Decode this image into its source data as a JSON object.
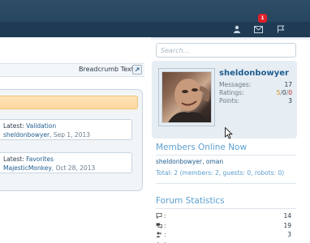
{
  "topnav": {
    "notification_count": "1",
    "icons": [
      "user-icon",
      "inbox-icon",
      "flag-icon"
    ]
  },
  "search": {
    "placeholder": "Search..."
  },
  "breadcrumb": {
    "text": "Breadcrumb Text"
  },
  "forum_list": {
    "items": [
      {
        "latest_label": "Latest:",
        "thread": "Validation",
        "user": "sheldonbowyer",
        "date": "Sep 1, 2013"
      },
      {
        "latest_label": "Latest:",
        "thread": "Favorites",
        "user": "MajesticMonkey",
        "date": "Oct 28, 2013"
      }
    ]
  },
  "visitor": {
    "username": "sheldonbowyer",
    "stats": [
      {
        "label": "Messages:",
        "value": "17"
      },
      {
        "label": "Ratings:",
        "pos": "5",
        "neu": "0",
        "neg": "0"
      },
      {
        "label": "Points:",
        "value": "3"
      }
    ]
  },
  "members_online": {
    "title": "Members Online Now",
    "users": "sheldonbowyer, oman",
    "total": "Total: 2 (members: 2, guests: 0, robots: 0)"
  },
  "forum_stats": {
    "title": "Forum Statistics",
    "rows": [
      {
        "icon": "speech-bubble-icon",
        "label": ":",
        "value": "14"
      },
      {
        "icon": "chat-bubbles-icon",
        "label": ":",
        "value": "19"
      },
      {
        "icon": "users-icon",
        "label": ":",
        "value": "3"
      },
      {
        "icon": "user-plus-icon",
        "label": ":",
        "value": ""
      }
    ]
  },
  "colors": {
    "header_bg": "#21405a",
    "link": "#1d5c8f",
    "section_title": "#5b9fcf",
    "badge": "#e0202a",
    "highlight_bar": "#fcd8a0"
  }
}
